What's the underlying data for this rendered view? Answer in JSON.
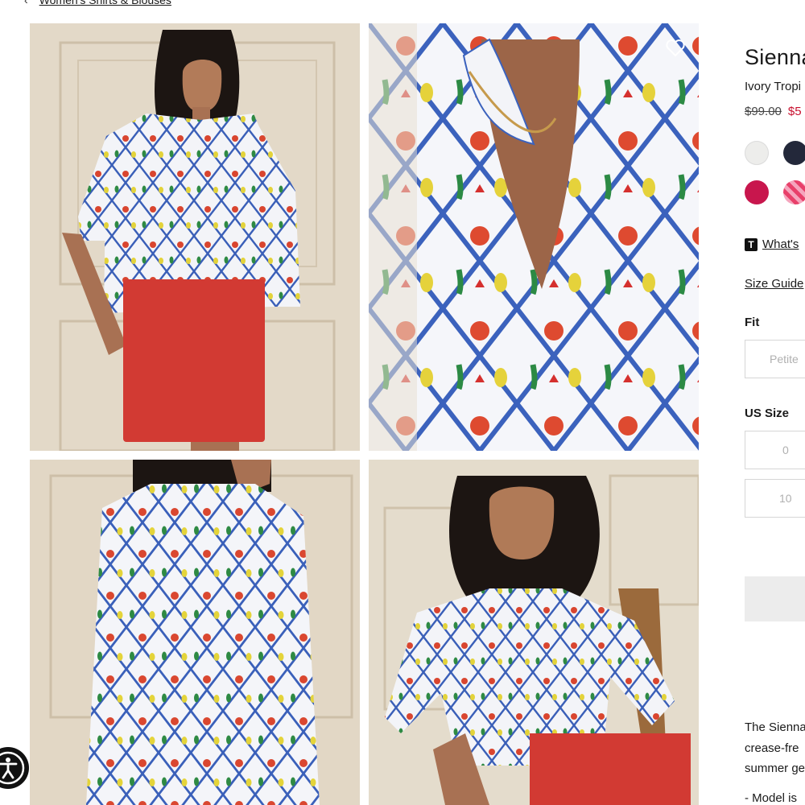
{
  "breadcrumb": {
    "back_icon": "chevron-left-icon",
    "label": "Women's Shirts & Blouses"
  },
  "gallery": {
    "favorite_icon": "heart-icon",
    "images": [
      {
        "name": "model-front-view"
      },
      {
        "name": "shirt-print-closeup"
      },
      {
        "name": "model-back-view"
      },
      {
        "name": "model-seated-view"
      }
    ]
  },
  "product": {
    "name": "Sienna",
    "color_name": "Ivory Tropi",
    "price_original": "$99.00",
    "price_sale": "$5",
    "swatches": [
      {
        "name": "swatch-ivory",
        "color": "#ededeb"
      },
      {
        "name": "swatch-navy",
        "color": "#23283a"
      },
      {
        "name": "swatch-raspberry",
        "color": "#c8164d"
      },
      {
        "name": "swatch-pink-print",
        "color": "#e8406a"
      }
    ],
    "whats_new_badge": "T",
    "whats_new_link": "What's",
    "size_guide_link": "Size Guide",
    "fit_label": "Fit",
    "fit_options": [
      "Petite"
    ],
    "size_label": "US Size",
    "size_options": [
      "0",
      "10"
    ],
    "description_lines": [
      "The Sienna",
      "crease-fre",
      "summer ge",
      "- Model is"
    ]
  },
  "accessibility_button_icon": "accessibility-icon",
  "colors": {
    "sale_red": "#c8102e",
    "accent_dark": "#111111"
  }
}
